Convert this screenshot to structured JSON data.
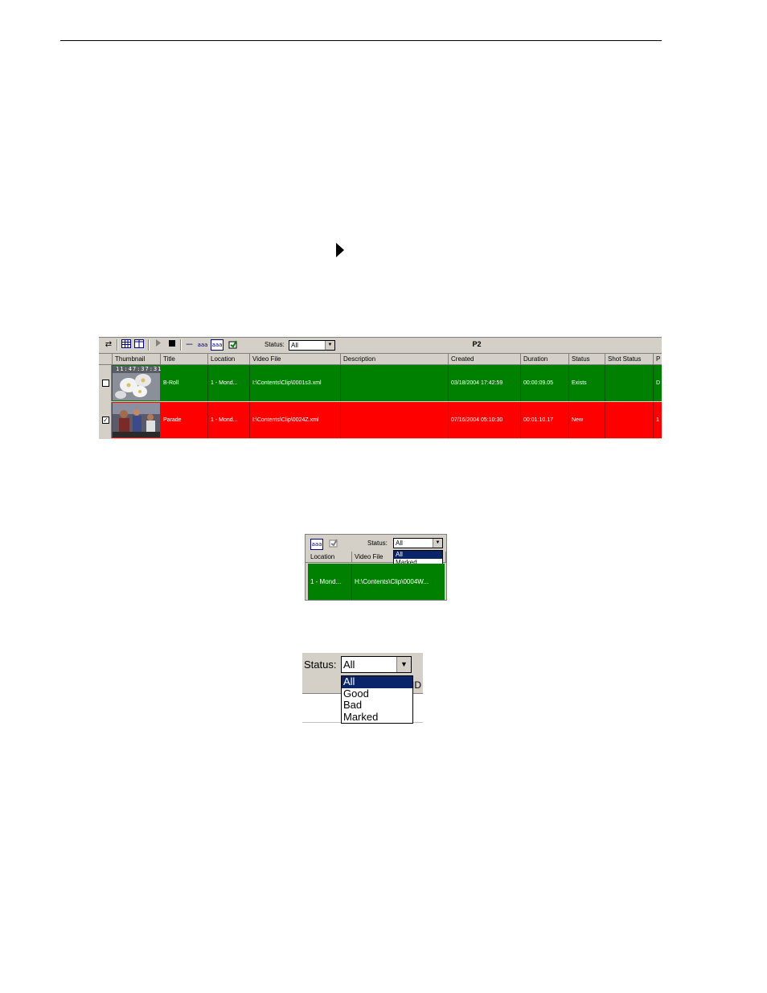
{
  "toolbar": {
    "status_label": "Status:",
    "status_value": "All",
    "panel_title": "P2",
    "icons": [
      "swap-icon",
      "grid-view-icon",
      "column-view-icon",
      "play-icon",
      "stop-icon",
      "dash-line-icon",
      "text-abc-icon",
      "text-abc-box-icon",
      "export-icon"
    ]
  },
  "table": {
    "columns": [
      "Thumbnail",
      "Title",
      "Location",
      "Video File",
      "Description",
      "Created",
      "Duration",
      "Status",
      "Shot Status",
      "P"
    ],
    "rows": [
      {
        "checked": false,
        "thumb_timecode": "11:47:37:31",
        "title": "B-Roll",
        "location": "1 - Mond...",
        "video_file": "I:\\Contents\\Clip\\0001s3.xml",
        "description": "",
        "created": "03/18/2004 17:42:59",
        "duration": "00:00:09.05",
        "status": "Exists",
        "shot_status": "",
        "p": "D"
      },
      {
        "checked": true,
        "title": "Parade",
        "location": "1 - Mond...",
        "video_file": "I:\\Contents\\Clip\\0024Z.xml",
        "description": "",
        "created": "07/16/2004 05:10:30",
        "duration": "00:01:10.17",
        "status": "New",
        "shot_status": "",
        "p": "1"
      }
    ]
  },
  "shot2": {
    "status_label": "Status:",
    "status_value": "All",
    "options": [
      "All",
      "Marked"
    ],
    "columns": [
      "Location",
      "Video File"
    ],
    "row": {
      "location": "1 - Mond...",
      "video_file": "H:\\Contents\\Clip\\0004W..."
    }
  },
  "shot3": {
    "status_label": "Status:",
    "status_value": "All",
    "options": [
      "All",
      "Good",
      "Bad",
      "Marked"
    ],
    "partial_header": "ID"
  },
  "colors": {
    "good": "#008000",
    "bad": "#ff0000",
    "selection": "#0a246a",
    "chrome": "#d4d0c8"
  }
}
